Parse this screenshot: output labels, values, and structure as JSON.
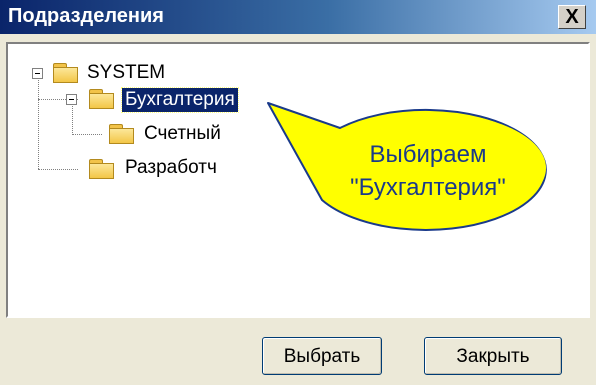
{
  "window": {
    "title": "Подразделения",
    "close_glyph": "X"
  },
  "tree": {
    "root": {
      "label": "SYSTEM",
      "icon": "folder-icon",
      "expanded": true
    },
    "child1": {
      "label": "Бухгалтерия",
      "icon": "folder-icon",
      "expanded": true,
      "selected": true
    },
    "grandchild1": {
      "label": "Счетный",
      "icon": "folder-icon"
    },
    "child2": {
      "label": "Разработч",
      "icon": "folder-icon"
    }
  },
  "callout": {
    "line1": "Выбираем",
    "line2": "\"Бухгалтерия\"",
    "fill_color": "#ffff00",
    "text_color": "#1a3a8a"
  },
  "buttons": {
    "select_label": "Выбрать",
    "close_label": "Закрыть"
  },
  "colors": {
    "titlebar_start": "#0a246a",
    "selection_bg": "#0a246a",
    "dialog_bg": "#ece9d8"
  }
}
